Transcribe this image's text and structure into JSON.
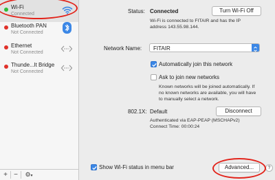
{
  "sidebar": {
    "services": [
      {
        "name": "Wi-Fi",
        "status": "Connected",
        "dot_color": "#2fbd37",
        "icon": "wifi-icon"
      },
      {
        "name": "Bluetooth PAN",
        "status": "Not Connected",
        "dot_color": "#e0312a",
        "icon": "bluetooth-icon"
      },
      {
        "name": "Ethernet",
        "status": "Not Connected",
        "dot_color": "#e0312a",
        "icon": "ethernet-icon"
      },
      {
        "name": "Thunde...lt Bridge",
        "status": "Not Connected",
        "dot_color": "#e0312a",
        "icon": "ethernet-icon"
      }
    ],
    "footer": {
      "add": "+",
      "remove": "−",
      "action": "⚙"
    }
  },
  "main": {
    "status_label": "Status:",
    "status_value": "Connected",
    "turn_off_button": "Turn Wi-Fi Off",
    "status_desc_1": "Wi-Fi is connected to FITAIR and has the IP",
    "status_desc_2": "address 143.55.98.144.",
    "network_name_label": "Network Name:",
    "network_name_value": "FITAIR",
    "auto_join_label": "Automatically join this network",
    "auto_join_checked": true,
    "ask_join_label": "Ask to join new networks",
    "ask_join_checked": false,
    "ask_desc_1": "Known networks will be joined automatically. If",
    "ask_desc_2": "no known networks are available, you will have",
    "ask_desc_3": "to manually select a network.",
    "dot1x_label": "802.1X:",
    "dot1x_value": "Default",
    "disconnect_button": "Disconnect",
    "auth_line_1": "Authenticated via EAP-PEAP (MSCHAPv2)",
    "auth_line_2": "Connect Time: 00:00:24",
    "show_status_label": "Show Wi-Fi status in menu bar",
    "show_status_checked": true,
    "advanced_button": "Advanced...",
    "help_button": "?"
  },
  "colors": {
    "accent": "#3b87e6",
    "annotation": "#e2231a"
  }
}
